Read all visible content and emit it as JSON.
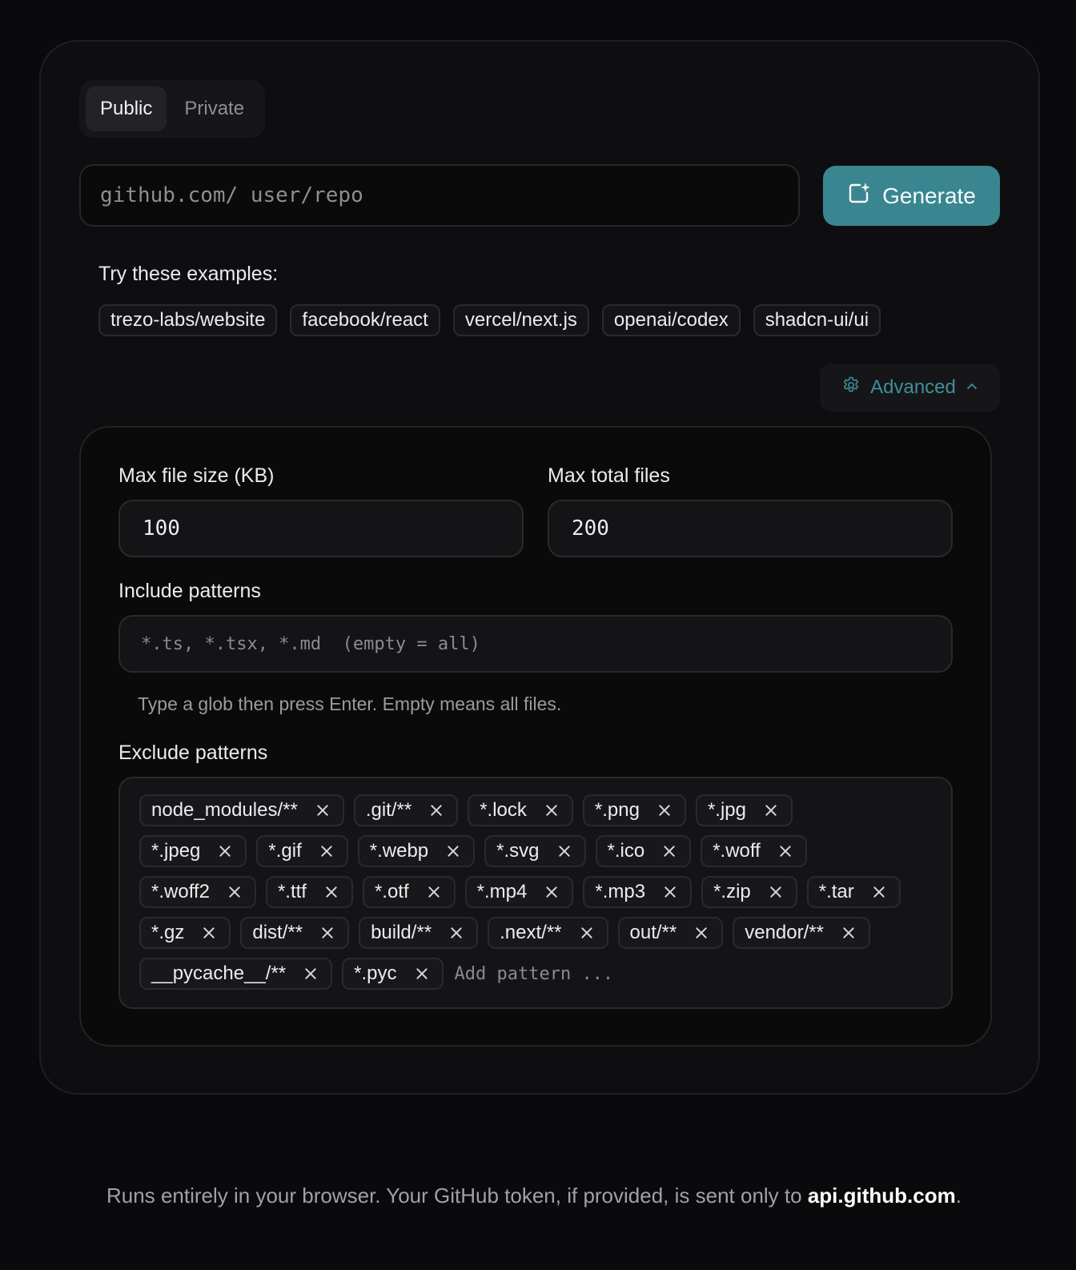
{
  "visibility_toggle": {
    "public_label": "Public",
    "private_label": "Private",
    "selected": "Public"
  },
  "repo_input": {
    "placeholder": "github.com/ user/repo",
    "value": ""
  },
  "generate_button": {
    "label": "Generate",
    "icon": "sparkle-doc-icon"
  },
  "examples": {
    "label": "Try these examples:",
    "items": [
      "trezo-labs/website",
      "facebook/react",
      "vercel/next.js",
      "openai/codex",
      "shadcn-ui/ui"
    ]
  },
  "advanced_button": {
    "label": "Advanced",
    "icon": "gear-icon",
    "expanded": true,
    "color": "#3f8f99"
  },
  "advanced": {
    "max_file_size_label": "Max file size (KB)",
    "max_file_size_value": "100",
    "max_total_files_label": "Max total files",
    "max_total_files_value": "200",
    "include_label": "Include patterns",
    "include_placeholder": "*.ts, *.tsx, *.md  (empty = all)",
    "include_hint": "Type a glob then press Enter. Empty means all files.",
    "exclude_label": "Exclude patterns",
    "exclude_tags": [
      [
        "node_modules/**",
        ".git/**",
        "*.lock",
        "*.png",
        "*.jpg"
      ],
      [
        "*.jpeg",
        "*.gif",
        "*.webp",
        "*.svg",
        "*.ico",
        "*.woff"
      ],
      [
        "*.woff2",
        "*.ttf",
        "*.otf",
        "*.mp4",
        "*.mp3",
        "*.zip",
        "*.tar"
      ],
      [
        "*.gz",
        "dist/**",
        "build/**",
        ".next/**",
        "out/**",
        "vendor/**"
      ],
      [
        "__pycache__/**",
        "*.pyc"
      ]
    ],
    "exclude_add_placeholder": "Add pattern ..."
  },
  "footer": {
    "text": "Runs entirely in your browser. Your GitHub token, if provided, is sent only to ",
    "domain": "api.github.com",
    "suffix": "."
  },
  "colors": {
    "accent": "#3a8690",
    "background": "#0a0a0c"
  }
}
